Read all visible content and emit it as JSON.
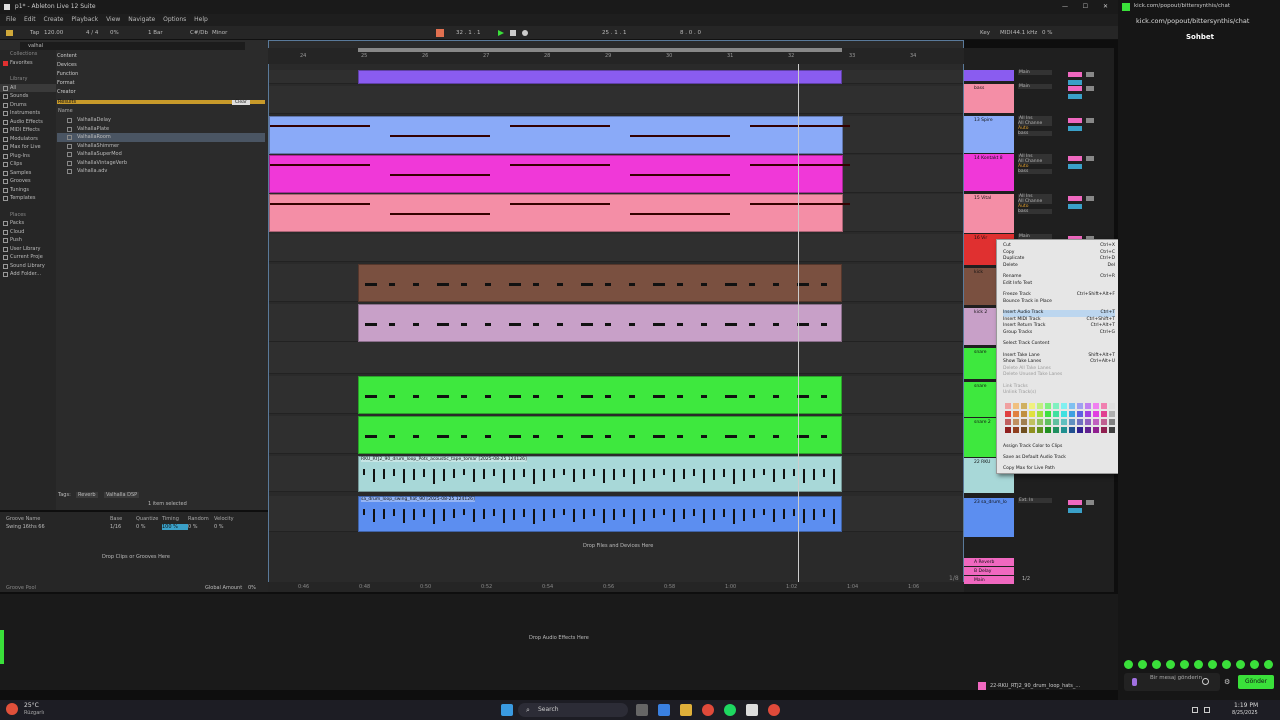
{
  "window": {
    "title": "p1* - Ableton Live 12 Suite"
  },
  "menu": [
    "File",
    "Edit",
    "Create",
    "Playback",
    "View",
    "Navigate",
    "Options",
    "Help"
  ],
  "transport": {
    "tap": "Tap",
    "tempo": "120.00",
    "signature": "4 / 4",
    "cpu": "0%",
    "quant": "1 Bar",
    "key_root": "C#/Db",
    "key_mode": "Minor",
    "position": "32 .  1 .  1",
    "loop_start": "25 .  1 .  1",
    "loop_len": "8 .  0 .  0",
    "key_label": "Key",
    "midi": "MIDI",
    "samplerate": "44.1 kHz",
    "cpu_pct": "0 %"
  },
  "browser": {
    "search": "valhal",
    "collections_label": "Collections",
    "favorites": "Favorites",
    "library_label": "Library",
    "library": [
      "All",
      "Sounds",
      "Drums",
      "Instruments",
      "Audio Effects",
      "MIDI Effects",
      "Modulators",
      "Max for Live",
      "Plug-Ins",
      "Clips",
      "Samples",
      "Grooves",
      "Tunings",
      "Templates"
    ],
    "places_label": "Places",
    "places": [
      "Packs",
      "Cloud",
      "Push",
      "User Library",
      "Current Proje",
      "Sound Library",
      "Add Folder..."
    ],
    "filters": [
      "Content",
      "Devices",
      "Function",
      "Format",
      "Creator"
    ],
    "results_label": "Results",
    "clear": "Clear",
    "name_col": "Name",
    "results": [
      "ValhallaDelay",
      "ValhallaPlate",
      "ValhallaRoom",
      "ValhallaShimmer",
      "ValhallaSuperMod",
      "ValhallaVintageVerb",
      "Valhalla.adv"
    ],
    "selected": "1 item selected",
    "tags_label": "Tags:",
    "tag1": "Reverb",
    "tag2": "Valhalla DSP"
  },
  "groove": {
    "cols": [
      "Groove Name",
      "Base",
      "Quantize",
      "Timing",
      "Random",
      "Velocity"
    ],
    "row": [
      "Swing 16ths 66",
      "1/16",
      "0 %",
      "100 %",
      "0 %",
      "0 %"
    ],
    "drop": "Drop Clips or Grooves Here",
    "pool": "Groove Pool",
    "global": "Global Amount",
    "global_val": "0%"
  },
  "ruler": {
    "bars": [
      "24",
      "25",
      "26",
      "27",
      "28",
      "29",
      "30",
      "31",
      "32",
      "33",
      "34"
    ],
    "times": [
      "0:46",
      "0:48",
      "0:50",
      "0:52",
      "0:54",
      "0:56",
      "0:58",
      "1:00",
      "1:02",
      "1:04",
      "1:06"
    ]
  },
  "clips": {
    "audio1": "RKU_RTJ2_90_drum_loop_Pots_acoustic_tape_tomar [2025-08-25 124126]",
    "audio2": "sa_drum_loop_swing_hat_90 [2025-08-25 124126]",
    "drop_files": "Drop Files and Devices Here",
    "drop_fx": "Drop Audio Effects Here",
    "quant": "1/8"
  },
  "tracks": [
    {
      "name": "",
      "color": "#8a5cf0"
    },
    {
      "name": "bass",
      "color": "#f48ea6"
    },
    {
      "name": "13 Spire",
      "color": "#8aaaf8"
    },
    {
      "name": "14 Kontakt 8",
      "color": "#f038d8"
    },
    {
      "name": "15 Vital",
      "color": "#f48ea6"
    },
    {
      "name": "16 Vir",
      "color": "#e03030"
    },
    {
      "name": "kick",
      "color": "#7a5040"
    },
    {
      "name": "kick 2",
      "color": "#c8a0c8"
    },
    {
      "name": "snare",
      "color": "#3ee83e"
    },
    {
      "name": "snare",
      "color": "#3ee83e"
    },
    {
      "name": "snare 2",
      "color": "#3ee83e"
    },
    {
      "name": "22 RKU",
      "color": "#a8d8d8"
    },
    {
      "name": "23 sa_drum_lo",
      "color": "#5c8ef0"
    }
  ],
  "returns": [
    {
      "name": "A Reverb",
      "color": "#f068c0"
    },
    {
      "name": "B Delay",
      "color": "#f068c0"
    },
    {
      "name": "Main",
      "color": "#f068c0"
    }
  ],
  "mixer": {
    "main": "Main",
    "allins": "All Ins",
    "allch": "All Channe",
    "in": "In",
    "auto": "Auto",
    "off": "Off",
    "bass": "bass",
    "extin": "Ext. In",
    "val": "-inf",
    "ratio": "1/2",
    "sends": "Sends",
    "set": "Set"
  },
  "context": [
    {
      "l": "Cut",
      "s": "Ctrl+X"
    },
    {
      "l": "Copy",
      "s": "Ctrl+C"
    },
    {
      "l": "Duplicate",
      "s": "Ctrl+D"
    },
    {
      "l": "Delete",
      "s": "Del"
    },
    {
      "l": "Rename",
      "s": "Ctrl+R"
    },
    {
      "l": "Edit Info Text",
      "s": ""
    },
    {
      "l": "Freeze Track",
      "s": "Ctrl+Shift+Alt+F"
    },
    {
      "l": "Bounce Track in Place",
      "s": ""
    },
    {
      "l": "Insert Audio Track",
      "s": "Ctrl+T"
    },
    {
      "l": "Insert MIDI Track",
      "s": "Ctrl+Shift+T"
    },
    {
      "l": "Insert Return Track",
      "s": "Ctrl+Alt+T"
    },
    {
      "l": "Group Tracks",
      "s": "Ctrl+G"
    },
    {
      "l": "Select Track Content",
      "s": ""
    },
    {
      "l": "Insert Take Lane",
      "s": "Shift+Alt+T"
    },
    {
      "l": "Show Take Lanes",
      "s": "Ctrl+Alt+U"
    },
    {
      "l": "Delete All Take Lanes",
      "s": ""
    },
    {
      "l": "Delete Unused Take Lanes",
      "s": ""
    },
    {
      "l": "Link Tracks",
      "s": ""
    },
    {
      "l": "Unlink Track(s)",
      "s": ""
    },
    {
      "l": "Assign Track Color to Clips",
      "s": ""
    },
    {
      "l": "Save as Default Audio Track",
      "s": ""
    },
    {
      "l": "Copy Max for Live Path",
      "s": ""
    }
  ],
  "chat": {
    "url": "kick.com/popout/bittersynthis/chat",
    "title": "Sohbet",
    "placeholder": "Bir mesaj gönderin",
    "send": "Gönder"
  },
  "statusbar": {
    "track": "22-RKU_RTJ2_90_drum_loop_hats_..."
  },
  "taskbar": {
    "temp": "25°C",
    "weather": "Rüzgarlı",
    "search": "Search",
    "time": "1:19 PM",
    "date": "8/25/2025"
  }
}
